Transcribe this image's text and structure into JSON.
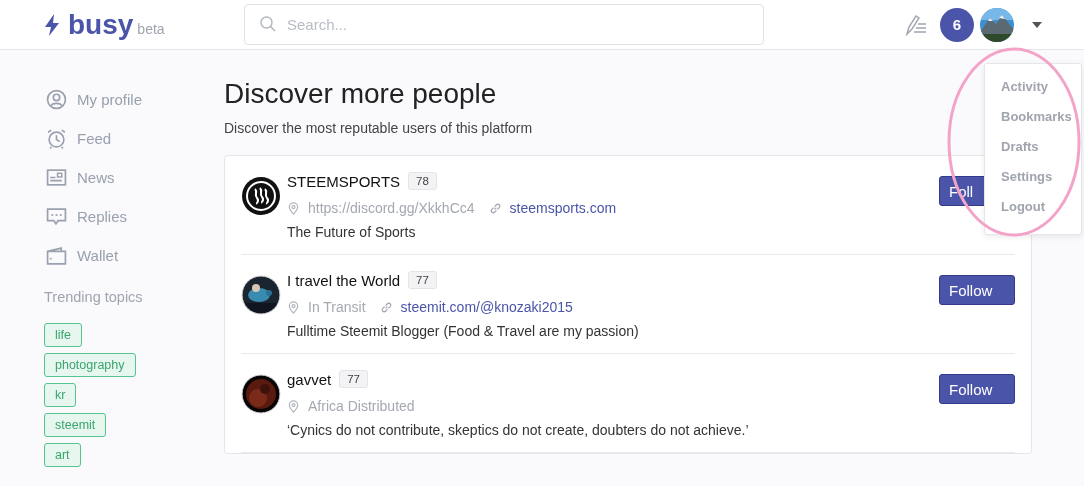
{
  "header": {
    "logo": "busy",
    "logo_tag": "beta",
    "search": {
      "placeholder": "Search..."
    },
    "notifications": "6"
  },
  "sidebar": {
    "items": [
      {
        "label": "My profile",
        "kind": "user"
      },
      {
        "label": "Feed",
        "kind": "clock"
      },
      {
        "label": "News",
        "kind": "news"
      },
      {
        "label": "Replies",
        "kind": "chat"
      },
      {
        "label": "Wallet",
        "kind": "wallet"
      }
    ],
    "trending_title": "Trending topics",
    "topics": [
      "life",
      "photography",
      "kr",
      "steemit",
      "art"
    ]
  },
  "main": {
    "title": "Discover more people",
    "subtitle": "Discover the most reputable users of this platform",
    "users": [
      {
        "name": "STEEMSPORTS",
        "reputation": "78",
        "kind": "logo",
        "location": "https://discord.gg/XkkhCc4",
        "website": "steemsports.com",
        "about": "The Future of Sports",
        "button": "Foll"
      },
      {
        "name": "I travel the World",
        "reputation": "77",
        "kind": "picture",
        "location": "In Transit",
        "website": "steemit.com/@knozaki2015",
        "about": "Fulltime Steemit Blogger (Food & Travel are my passion)",
        "button": "Follow"
      },
      {
        "name": "gavvet",
        "reputation": "77",
        "kind": "picture",
        "location": "Africa Distributed",
        "about": "‘Cynics do not contribute, skeptics do not create, doubters do not achieve.’",
        "button": "Follow"
      }
    ]
  },
  "dropdown": {
    "items": [
      "Activity",
      "Bookmarks",
      "Drafts",
      "Settings",
      "Logout"
    ]
  }
}
